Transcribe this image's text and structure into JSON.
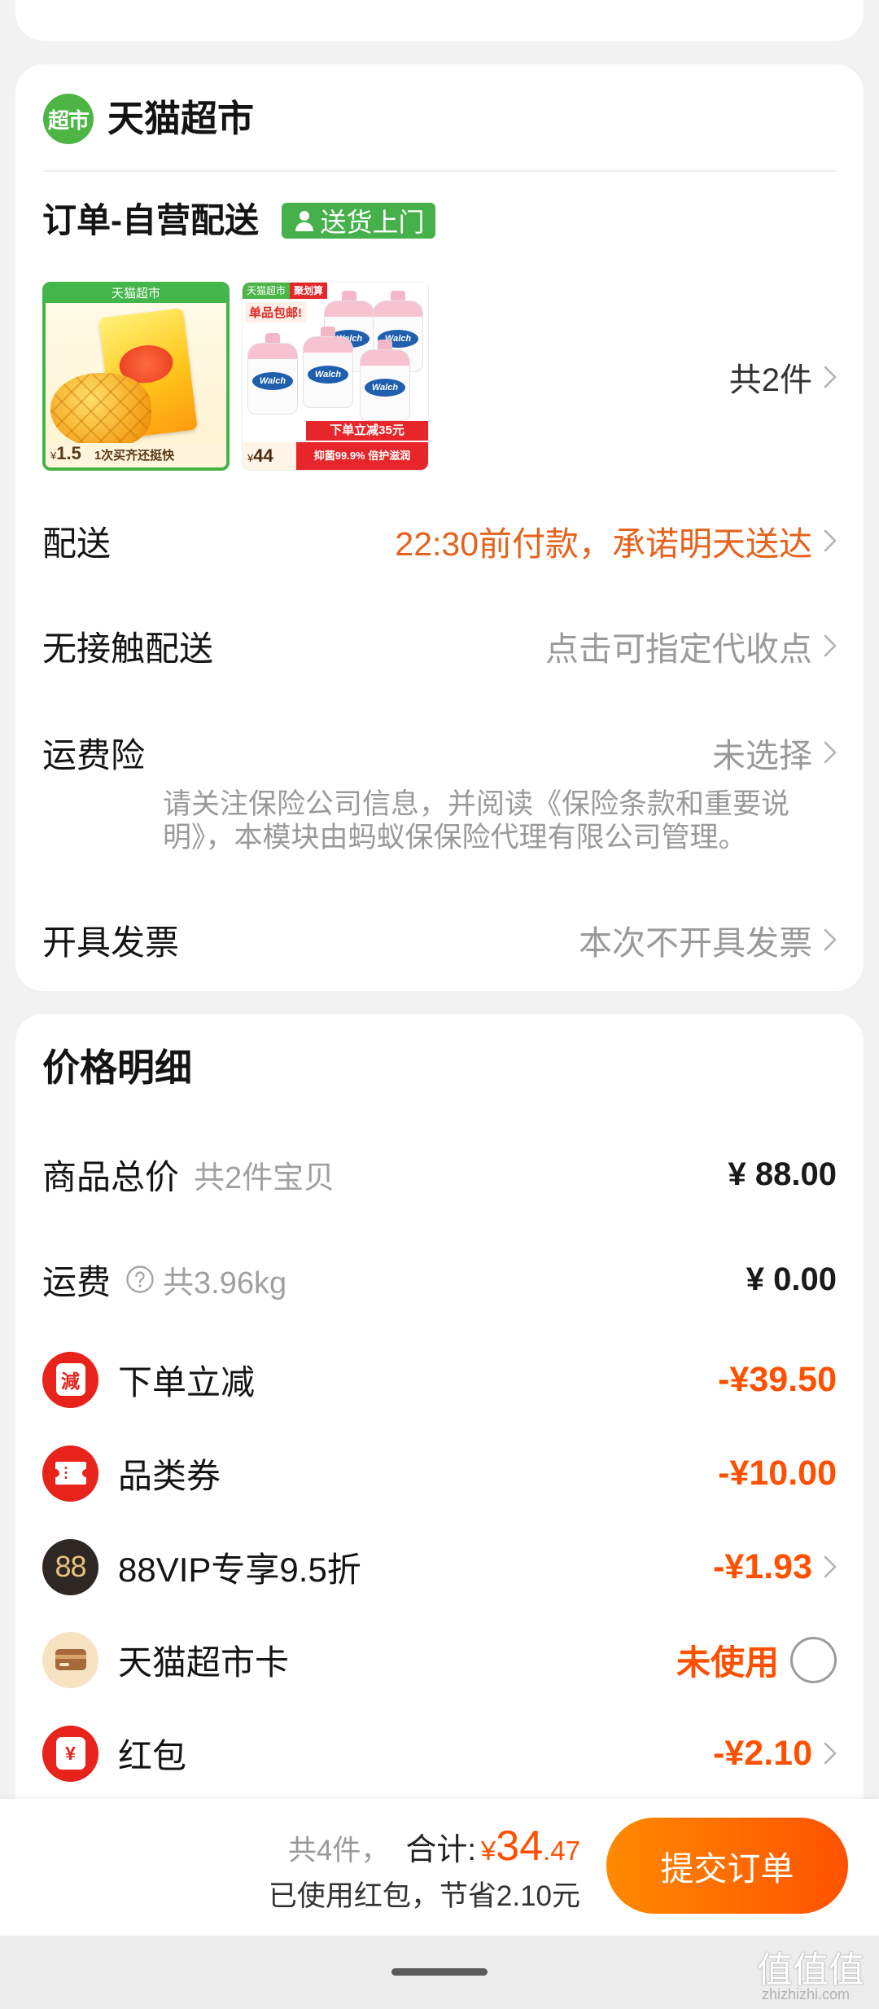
{
  "store": {
    "logo_text": "超市",
    "name": "天猫超市"
  },
  "order": {
    "title": "订单-自营配送",
    "badge": "送货上门",
    "item_count": "共2件",
    "products": [
      {
        "banner": "天猫超市",
        "currency": "¥",
        "price": "1.5",
        "slogan": "1次买齐还挺快"
      },
      {
        "tag": "天猫超市",
        "tag2": "聚划算",
        "promo": "单品包邮!",
        "brand": "Walch",
        "discount": "下单立减35元",
        "currency": "¥",
        "price": "44",
        "slogan": "抑菌99.9% 倍护滋润"
      }
    ]
  },
  "delivery": {
    "rows": [
      {
        "label": "配送",
        "value": "22:30前付款，承诺明天送达"
      },
      {
        "label": "无接触配送",
        "value": "点击可指定代收点"
      },
      {
        "label": "运费险",
        "value": "未选择",
        "note": "请关注保险公司信息，并阅读《保险条款和重要说明》，本模块由蚂蚁保保险代理有限公司管理。"
      },
      {
        "label": "开具发票",
        "value": "本次不开具发票"
      }
    ]
  },
  "price": {
    "title": "价格明细",
    "rows": [
      {
        "label": "商品总价",
        "sub": "共2件宝贝",
        "value": "¥ 88.00"
      },
      {
        "label": "运费",
        "icon": "help-icon",
        "sub": "共3.96kg",
        "value": "¥ 0.00"
      },
      {
        "label": "下单立减",
        "icon": "discount-icon",
        "icon_text": "減",
        "value": "-¥39.50"
      },
      {
        "label": "品类券",
        "icon": "coupon-icon",
        "value": "-¥10.00"
      },
      {
        "label": "88VIP专享9.5折",
        "icon": "vip88-icon",
        "icon_text": "88",
        "value": "-¥1.93"
      },
      {
        "label": "天猫超市卡",
        "icon": "supermarket-card-icon",
        "value": "未使用"
      },
      {
        "label": "红包",
        "icon": "red-packet-icon",
        "icon_text": "¥",
        "value": "-¥2.10"
      }
    ]
  },
  "footer": {
    "count": "共4件，",
    "total_label": "合计:",
    "currency": "¥",
    "total_int": "34",
    "total_dec": ".47",
    "saving": "已使用红包，节省2.10元",
    "submit": "提交订单"
  },
  "watermark": {
    "text": "值值值",
    "domain": "zhizhizhi.com"
  },
  "colors": {
    "accent": "#ff5000",
    "brand_green": "#46b14a",
    "highlight_orange": "#e6621c",
    "muted": "#9a9a9a"
  }
}
